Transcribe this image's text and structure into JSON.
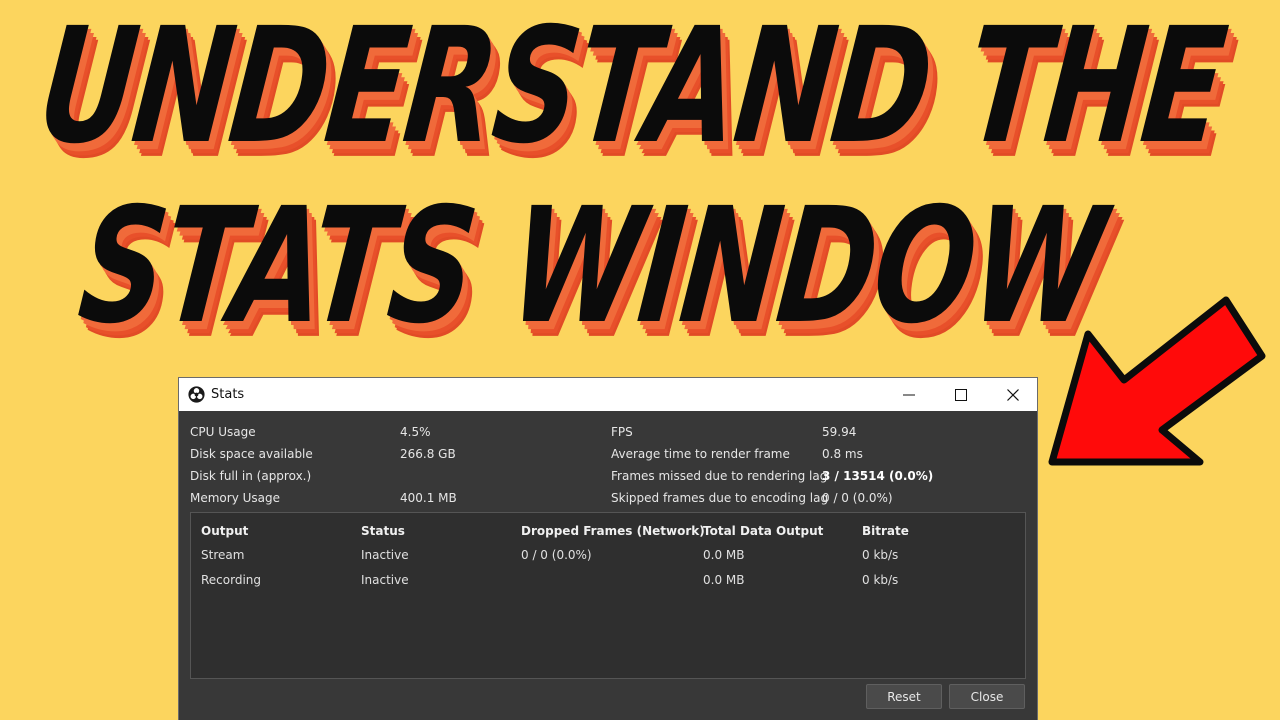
{
  "headline": {
    "line1": "UNDERSTAND THE",
    "line2": "STATS WINDOW"
  },
  "colors": {
    "background": "#fcd55e",
    "headline_text": "#0b0b0b",
    "headline_shadow": "#f06a3a",
    "arrow_fill": "#ff0a0a",
    "window_bg": "#383838",
    "panel_bg": "#2f2f2f"
  },
  "window": {
    "title": "Stats",
    "app_icon": "obs-logo-icon",
    "controls": {
      "minimize": "—",
      "maximize": "☐",
      "close": "✕"
    }
  },
  "stats_left": [
    {
      "label": "CPU Usage",
      "value": "4.5%"
    },
    {
      "label": "Disk space available",
      "value": "266.8 GB"
    },
    {
      "label": "Disk full in (approx.)",
      "value": ""
    },
    {
      "label": "Memory Usage",
      "value": "400.1 MB"
    }
  ],
  "stats_right": [
    {
      "label": "FPS",
      "value": "59.94"
    },
    {
      "label": "Average time to render frame",
      "value": "0.8 ms"
    },
    {
      "label": "Frames missed due to rendering lag",
      "value": "3 / 13514 (0.0%)"
    },
    {
      "label": "Skipped frames due to encoding lag",
      "value": "0 / 0 (0.0%)"
    }
  ],
  "output_table": {
    "headers": [
      "Output",
      "Status",
      "Dropped Frames (Network)",
      "Total Data Output",
      "Bitrate"
    ],
    "rows": [
      [
        "Stream",
        "Inactive",
        "0 / 0 (0.0%)",
        "0.0 MB",
        "0 kb/s"
      ],
      [
        "Recording",
        "Inactive",
        "",
        "0.0 MB",
        "0 kb/s"
      ]
    ]
  },
  "buttons": {
    "reset": "Reset",
    "close": "Close"
  }
}
